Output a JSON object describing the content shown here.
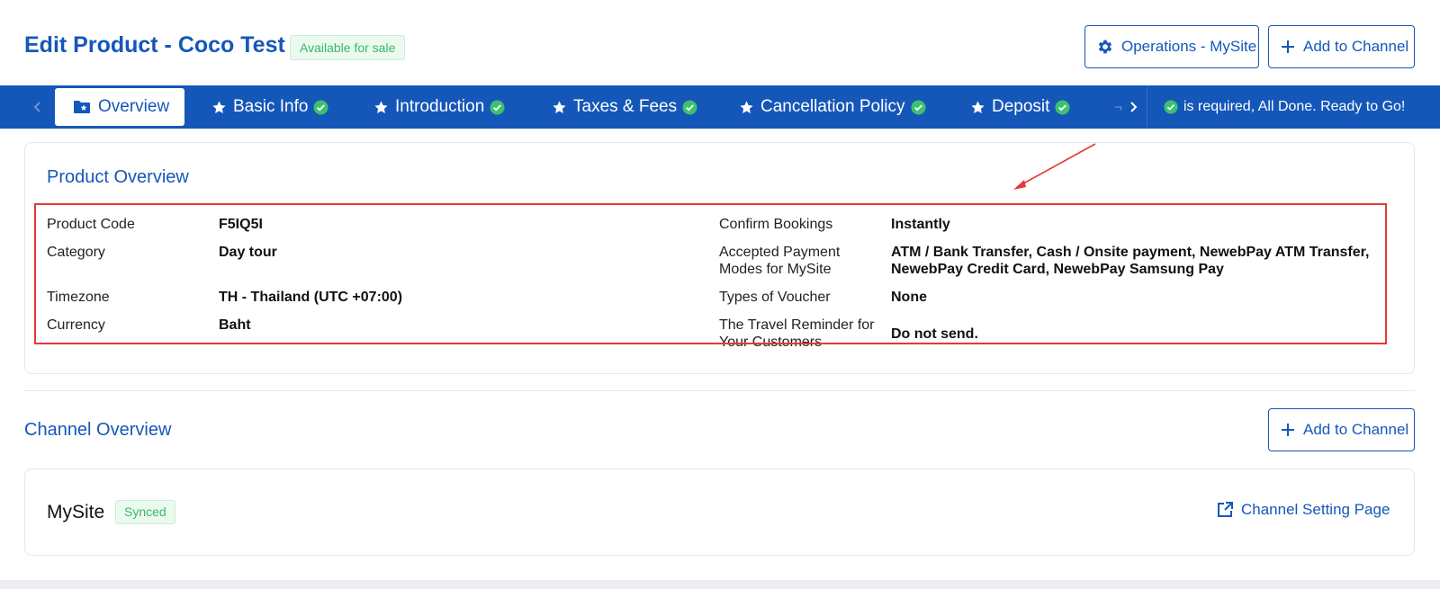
{
  "header": {
    "title": "Edit Product - Coco Test",
    "status_badge": "Available for sale",
    "operations_button": "Operations - MySite",
    "add_channel_button": "Add to Channel"
  },
  "tabs": [
    {
      "label": "Overview",
      "active": true,
      "icon": "folder-star-icon"
    },
    {
      "label": "Basic Info",
      "complete": true
    },
    {
      "label": "Introduction",
      "complete": true
    },
    {
      "label": "Taxes & Fees",
      "complete": true
    },
    {
      "label": "Cancellation Policy",
      "complete": true
    },
    {
      "label": "Deposit",
      "complete": true
    }
  ],
  "tab_faded_text": "¬",
  "tab_status": "is required,  All Done. Ready to Go!",
  "product_overview": {
    "title": "Product Overview",
    "left_fields": [
      {
        "label": "Product Code",
        "value": "F5IQ5I"
      },
      {
        "label": "Category",
        "value": "Day tour"
      },
      {
        "label": "Timezone",
        "value": "TH - Thailand (UTC +07:00)"
      },
      {
        "label": "Currency",
        "value": "Baht"
      }
    ],
    "right_fields": [
      {
        "label": "Confirm Bookings",
        "value": "Instantly"
      },
      {
        "label_line1": "Accepted Payment",
        "label_line2": "Modes for MySite",
        "value_line1": "ATM / Bank Transfer, Cash / Onsite payment, NewebPay ATM Transfer,",
        "value_line2": "NewebPay Credit Card, NewebPay Samsung Pay"
      },
      {
        "label": "Types of Voucher",
        "value": "None"
      },
      {
        "label_line1": "The Travel Reminder for",
        "label_line2": "Your Customers",
        "value": "Do not send."
      }
    ]
  },
  "channel_overview": {
    "title": "Channel Overview",
    "add_channel_button": "Add to Channel",
    "channel": {
      "name": "MySite",
      "status": "Synced",
      "setting_link": "Channel Setting Page"
    }
  },
  "colors": {
    "primary": "#1557b9",
    "success": "#3cb56a",
    "highlight": "#e53935"
  }
}
